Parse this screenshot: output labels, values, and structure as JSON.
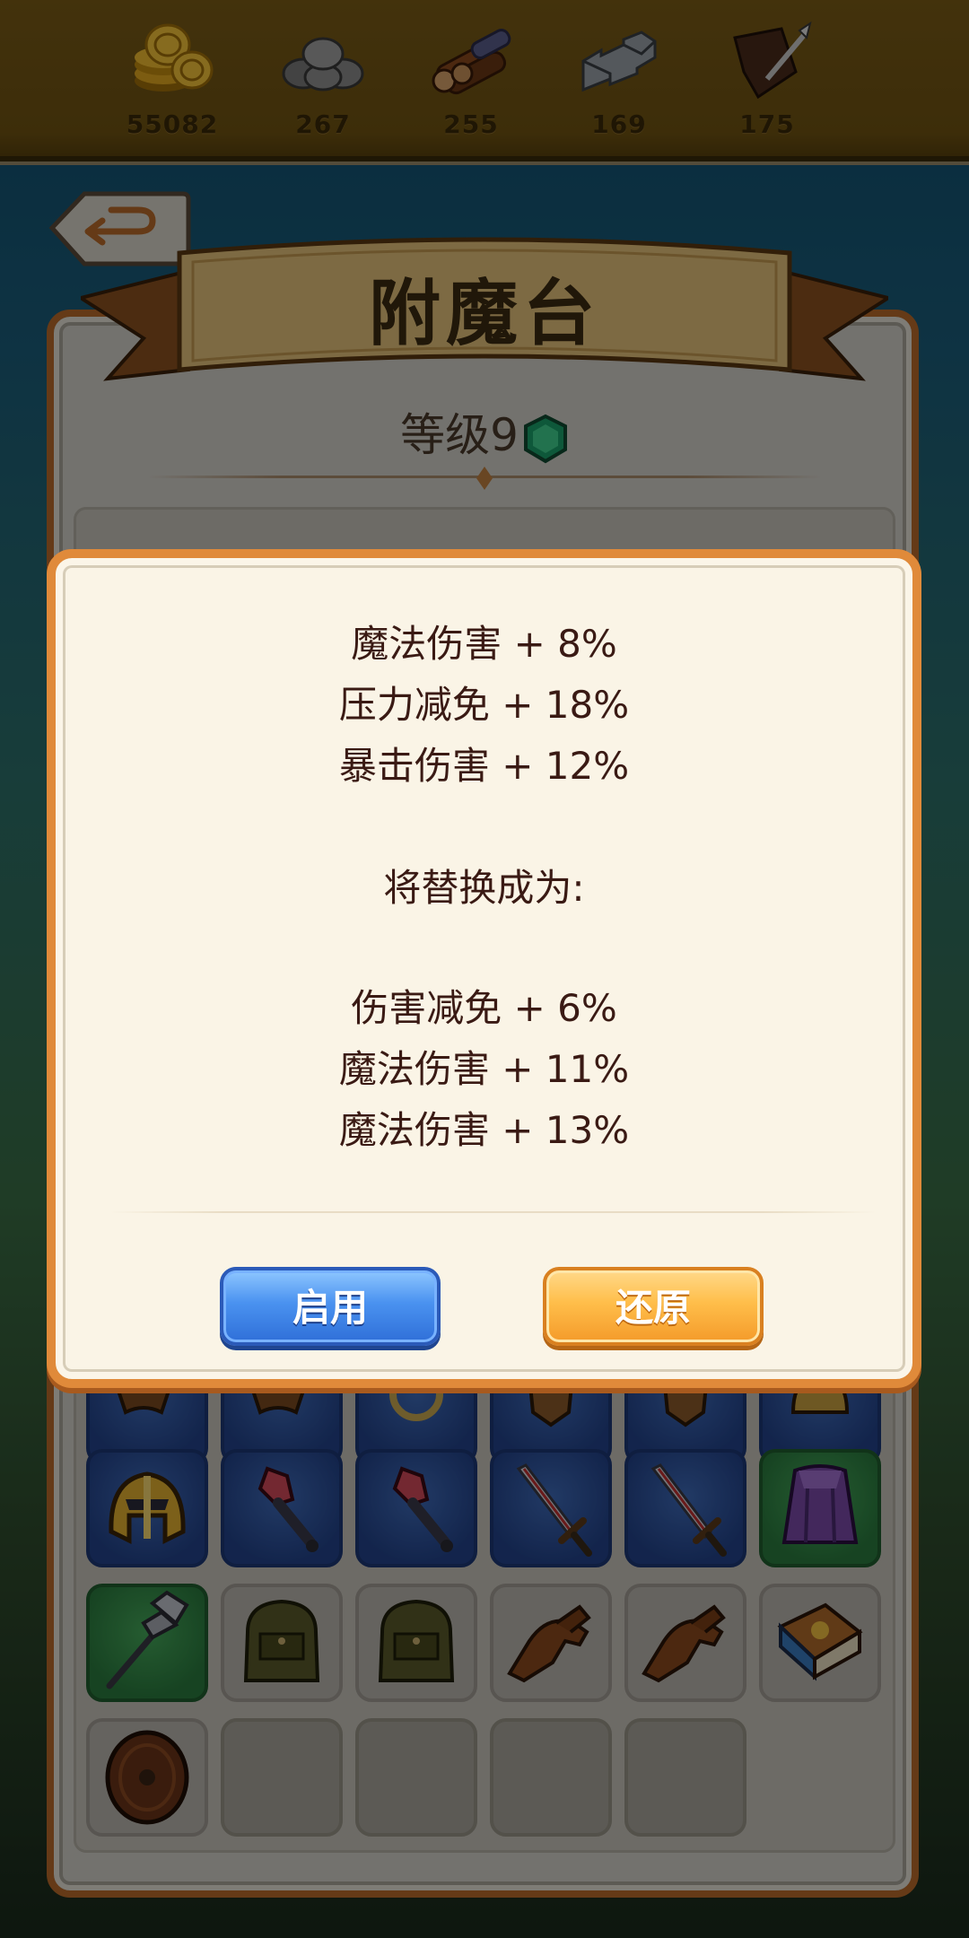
{
  "resources": [
    {
      "name": "coin-icon",
      "value": "55082"
    },
    {
      "name": "stone-icon",
      "value": "267"
    },
    {
      "name": "wood-icon",
      "value": "255"
    },
    {
      "name": "iron-icon",
      "value": "169"
    },
    {
      "name": "leather-icon",
      "value": "175"
    }
  ],
  "header": {
    "title": "附魔台",
    "level_label": "等级9"
  },
  "dialog": {
    "current_stats": [
      "魔法伤害 + 8%",
      "压力减免 + 18%",
      "暴击伤害 + 12%"
    ],
    "replace_label": "将替换成为:",
    "new_stats": [
      "伤害减免 + 6%",
      "魔法伤害 + 11%",
      "魔法伤害 + 13%"
    ],
    "enable_button": "启用",
    "restore_button": "还原"
  },
  "inventory": [
    {
      "row": 1,
      "items": [
        "claw",
        "claw",
        "ring",
        "shield",
        "shield",
        "helmet"
      ],
      "rarity": [
        "blue",
        "blue",
        "blue",
        "blue",
        "blue",
        "blue"
      ]
    },
    {
      "row": 2,
      "items": [
        "golden-helmet",
        "crystal-staff",
        "crystal-staff",
        "sword",
        "sword",
        "purple-cloak"
      ],
      "rarity": [
        "blue",
        "blue",
        "blue",
        "blue",
        "blue",
        "green"
      ]
    },
    {
      "row": 3,
      "items": [
        "battle-axe",
        "backpack",
        "backpack",
        "glove",
        "glove",
        "spell-book"
      ],
      "rarity": [
        "green",
        "grey",
        "grey",
        "grey",
        "grey",
        "grey"
      ]
    },
    {
      "row": 4,
      "items": [
        "round-shield",
        "empty",
        "empty",
        "empty",
        "empty"
      ],
      "rarity": [
        "grey",
        "empty",
        "empty",
        "empty",
        "empty"
      ]
    }
  ],
  "colors": {
    "dialog_border": "#e08a3a",
    "enable_button": "#4a92f0",
    "restore_button": "#ffbe4a",
    "stat_text": "#3a1a14"
  }
}
